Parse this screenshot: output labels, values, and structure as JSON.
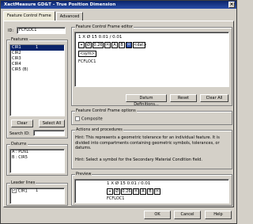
{
  "window": {
    "title": "XactMeasure GD&T - True Position Dimension",
    "close_glyph": "×"
  },
  "tabs": [
    {
      "label": "Feature Control Frame"
    },
    {
      "label": "Advanced"
    }
  ],
  "id_field": {
    "label": "ID:",
    "value": "FCFLOC1"
  },
  "features": {
    "label": "Features",
    "items": [
      {
        "name": "CIR1",
        "count": "1"
      },
      {
        "name": "CIR2",
        "count": ""
      },
      {
        "name": "CIR3",
        "count": ""
      },
      {
        "name": "CIR4",
        "count": ""
      },
      {
        "name": "CIR5 (B)",
        "count": ""
      }
    ],
    "clear_label": "Clear",
    "select_all_label": "Select All",
    "search_label": "Search ID:",
    "search_value": ""
  },
  "datums": {
    "label": "Datums",
    "items": [
      "A : PLN1",
      "B : CIR5"
    ]
  },
  "leader_lines": {
    "label": "Leader lines",
    "items": [
      {
        "name": "CIR1",
        "count": "1",
        "checked": true
      }
    ]
  },
  "editor": {
    "label": "Feature Control Frame editor",
    "line1": "1  X  Ø  15  0.01  /  0.01",
    "frame_symbols": [
      "⌖",
      "Ø",
      "0.26",
      "Ⓜ",
      "A",
      "B",
      "Ⓜ",
      "<dat>"
    ],
    "sym_label": "<sym>",
    "name": "FCFLOC1",
    "datum_defs_label": "Datum Definitions...",
    "reset_label": "Reset",
    "clear_all_label": "Clear All"
  },
  "options": {
    "label": "Feature Control Frame options",
    "composite_label": "Composite"
  },
  "actions": {
    "label": "Actions and procedures",
    "hint1": "Hint:  This represents a geometric tolerance for an individual feature.  It is divided into compartments containing geometric symbols, tolerances, or datums.",
    "hint2": "Hint:  Select a symbol for the Secondary Material Condition field."
  },
  "preview": {
    "label": "Preview",
    "line1": "1  X  Ø  15  0.01  /  0.01",
    "frame_symbols": [
      "⌖",
      "Ø",
      "0.26",
      "Ⓜ",
      "A",
      "B",
      "Ⓜ"
    ],
    "name": "FCFLOC1"
  },
  "buttons": {
    "ok": "OK",
    "cancel": "Cancel",
    "help": "Help"
  }
}
